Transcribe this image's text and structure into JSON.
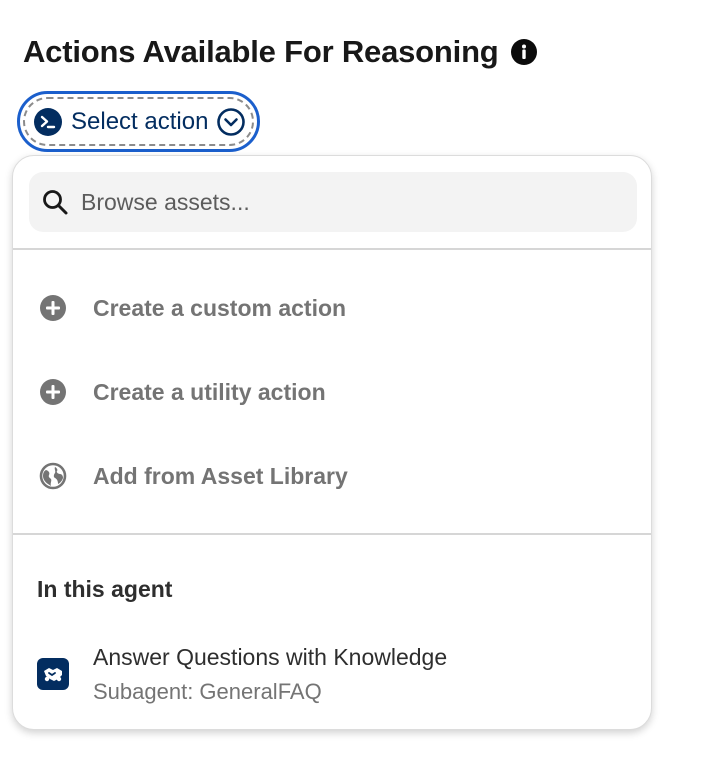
{
  "section": {
    "title": "Actions Available For Reasoning",
    "info_icon": "info-icon"
  },
  "select_button": {
    "label": "Select action",
    "left_icon": "prompt-terminal-icon",
    "right_icon": "chevron-down-circle-icon"
  },
  "dropdown": {
    "search": {
      "placeholder": "Browse assets...",
      "value": "",
      "icon": "search-icon"
    },
    "menu_items": [
      {
        "label": "Create a custom action",
        "icon": "add-circle-icon"
      },
      {
        "label": "Create a utility action",
        "icon": "add-circle-icon"
      },
      {
        "label": "Add from Asset Library",
        "icon": "globe-icon"
      }
    ],
    "group": {
      "heading": "In this agent",
      "items": [
        {
          "title": "Answer Questions with Knowledge",
          "subtitle": "Subagent: GeneralFAQ",
          "icon": "knowledge-handshake-icon"
        }
      ]
    }
  },
  "colors": {
    "accent_blue": "#1b5fcc",
    "navy": "#032d60",
    "muted_text": "#747474"
  }
}
